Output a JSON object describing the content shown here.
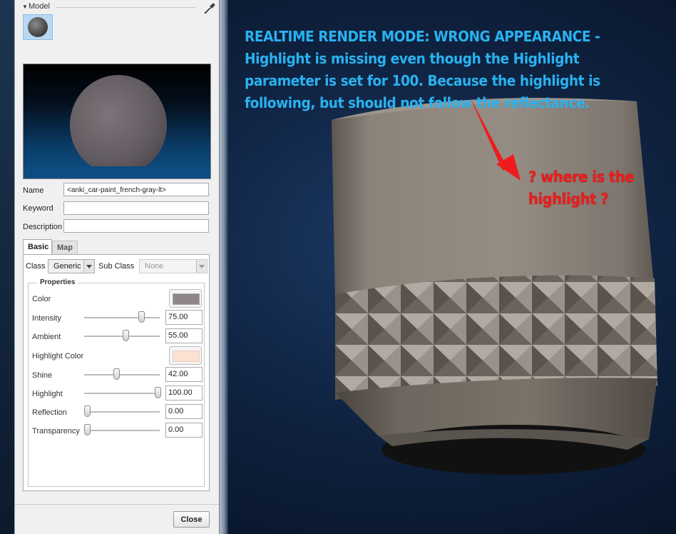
{
  "panel": {
    "section_label": "Model",
    "fields": {
      "name_label": "Name",
      "name_value": "<anki_car-paint_french-gray-lt>",
      "keyword_label": "Keyword",
      "keyword_value": "",
      "description_label": "Description",
      "description_value": ""
    },
    "tabs": [
      {
        "label": "Basic",
        "active": true
      },
      {
        "label": "Map",
        "active": false
      }
    ],
    "class_label": "Class",
    "class_value": "Generic",
    "subclass_label": "Sub Class",
    "subclass_value": "None",
    "properties_title": "Properties",
    "properties": {
      "color_label": "Color",
      "color_hex": "#8e8689",
      "intensity_label": "Intensity",
      "intensity_value": "75.00",
      "ambient_label": "Ambient",
      "ambient_value": "55.00",
      "highlight_color_label": "Highlight Color",
      "highlight_color_hex": "#fbe1d2",
      "shine_label": "Shine",
      "shine_value": "42.00",
      "highlight_label": "Highlight",
      "highlight_value": "100.00",
      "reflection_label": "Reflection",
      "reflection_value": "0.00",
      "transparency_label": "Transparency",
      "transparency_value": "0.00"
    },
    "close_label": "Close"
  },
  "annotations": {
    "main_note": "REALTIME RENDER MODE: WRONG APPEARANCE - Highlight is missing even though the Highlight parameter is set for 100.  Because the highlight is following, but should not follow the reflectance.",
    "callout": "? where is the highlight ?",
    "main_color": "#29b2f0",
    "callout_color": "#ee1c1c"
  }
}
